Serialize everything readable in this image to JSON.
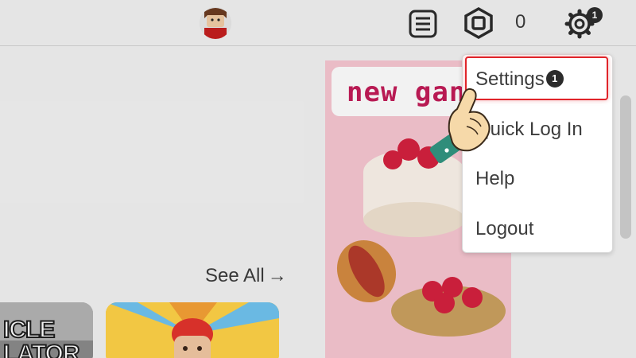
{
  "header": {
    "avatar_label": "avatar",
    "robux_count": "0",
    "notification_badge": "1"
  },
  "main": {
    "see_all_label": "See All",
    "see_all_arrow": "→",
    "tiles": [
      {
        "text": "ICLE\nLATOR"
      },
      {
        "text": ""
      }
    ]
  },
  "ad": {
    "title": "new gan"
  },
  "dropdown": {
    "items": [
      {
        "label": "Settings",
        "badge": "1"
      },
      {
        "label": "Quick Log In"
      },
      {
        "label": "Help"
      },
      {
        "label": "Logout"
      }
    ]
  },
  "colors": {
    "highlight": "#e0242a",
    "ad_bg": "#f7c6d1",
    "ad_title": "#c21a57"
  },
  "icons": [
    "list-icon",
    "robux-icon",
    "gear-icon",
    "hand-pointer-icon",
    "arrow-right-icon"
  ]
}
